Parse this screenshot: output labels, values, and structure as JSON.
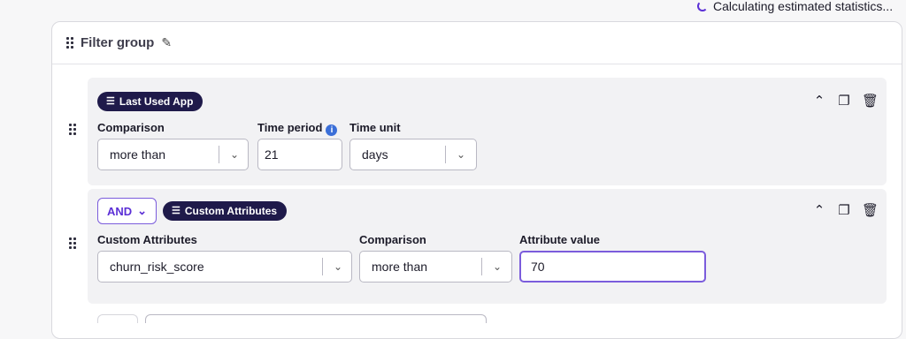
{
  "status": {
    "text": "Calculating estimated statistics..."
  },
  "filter_group": {
    "title": "Filter group"
  },
  "filter1": {
    "tag": "Last Used App",
    "comparison_label": "Comparison",
    "comparison_value": "more than",
    "time_period_label": "Time period",
    "time_period_value": "21",
    "time_unit_label": "Time unit",
    "time_unit_value": "days"
  },
  "filter2": {
    "operator": "AND",
    "tag": "Custom Attributes",
    "attribute_label": "Custom Attributes",
    "attribute_value": "churn_risk_score",
    "comparison_label": "Comparison",
    "comparison_value": "more than",
    "value_label": "Attribute value",
    "value": "70"
  },
  "icons": {
    "drag": "drag-handle-icon",
    "edit": "pencil-icon",
    "collapse": "chevron-up-icon",
    "duplicate": "copy-icon",
    "delete": "trash-icon",
    "info": "info-icon",
    "dropdown": "chevron-down-icon",
    "tag": "sliders-icon"
  },
  "colors": {
    "accent": "#5b2fd6",
    "tag_bg": "#1f1a4a",
    "info": "#3b6fd8"
  }
}
